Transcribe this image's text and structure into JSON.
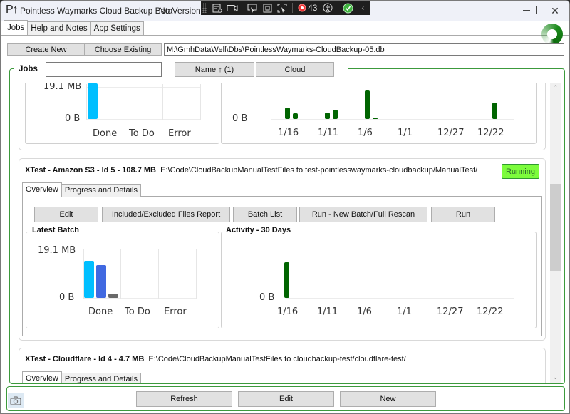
{
  "window": {
    "app_logo": "P↑",
    "title": "Pointless Waymarks Cloud Backup Beta",
    "version": "No Version",
    "minimize_glyph": "—",
    "maximize_glyph": "☐",
    "close_glyph": "✕"
  },
  "debug_toolbar": {
    "items": [
      "live-visual-tree-icon",
      "record-icon",
      "select-element-icon",
      "display-layout-adorners-icon",
      "track-focused-element-icon"
    ],
    "binding_failures": "43",
    "accessibility_icon": "☺",
    "status": "ok",
    "collapse_glyph": "‹"
  },
  "tabs": [
    {
      "label": "Jobs",
      "active": true
    },
    {
      "label": "Help and Notes",
      "active": false
    },
    {
      "label": "App Settings",
      "active": false
    }
  ],
  "database": {
    "create_new_label": "Create New",
    "choose_existing_label": "Choose Existing",
    "path": "M:\\GmhDataWell\\Dbs\\PointlessWaymarks-CloudBackup-05.db"
  },
  "jobs": {
    "legend": "Jobs",
    "filter_value": "",
    "sort_name_label": "Name ↑ (1)",
    "sort_cloud_label": "Cloud",
    "partial_card": {
      "latest_batch": {
        "y_max_label": "19.1 MB",
        "y_min_label": "0 B",
        "categories": [
          "Done",
          "To Do",
          "Error"
        ],
        "bars": [
          {
            "category": "Done",
            "color": "#00bfff",
            "fraction": 1.0
          }
        ]
      },
      "activity": {
        "y_min_label": "0 B",
        "x_labels": [
          "1/16",
          "1/11",
          "1/6",
          "1/1",
          "12/27",
          "12/22"
        ],
        "bars": [
          {
            "day_offset": 0,
            "fraction": 0.4
          },
          {
            "day_offset": 1,
            "fraction": 0.2
          },
          {
            "day_offset": 5,
            "fraction": 0.23
          },
          {
            "day_offset": 6,
            "fraction": 0.33
          },
          {
            "day_offset": 10,
            "fraction": 1.0
          },
          {
            "day_offset": 11,
            "fraction": 0.03
          },
          {
            "day_offset": 26,
            "fraction": 0.58
          }
        ]
      }
    },
    "cards": [
      {
        "name": "XTest - Amazon S3 - Id 5 - 108.7 MB",
        "description": "E:\\Code\\CloudBackupManualTestFiles to test-pointlesswaymarks-cloudbackup/ManualTest/",
        "status": "Running",
        "tabs": [
          {
            "label": "Overview",
            "active": true
          },
          {
            "label": "Progress and Details",
            "active": false
          }
        ],
        "buttons": [
          "Edit",
          "Included/Excluded Files Report",
          "Batch List",
          "Run - New Batch/Full Rescan",
          "Run"
        ],
        "latest_batch": {
          "title": "Latest Batch",
          "y_max_label": "19.1 MB",
          "y_min_label": "0 B",
          "categories": [
            "Done",
            "To Do",
            "Error"
          ],
          "bars": [
            {
              "category": "Done",
              "series": "uploaded",
              "color": "#00bfff",
              "fraction": 0.82
            },
            {
              "category": "Done",
              "series": "in-progress",
              "color": "#4169e1",
              "fraction": 0.72
            },
            {
              "category": "Done",
              "series": "other",
              "color": "#696969",
              "fraction": 0.1
            }
          ]
        },
        "activity": {
          "title": "Activity - 30 Days",
          "y_min_label": "0 B",
          "x_labels": [
            "1/16",
            "1/11",
            "1/6",
            "1/1",
            "12/27",
            "12/22"
          ],
          "bars": [
            {
              "day_offset": 0,
              "fraction": 1.0
            }
          ]
        }
      },
      {
        "name": "XTest - Cloudflare - Id 4 - 4.7 MB",
        "description": "E:\\Code\\CloudBackupManualTestFiles to cloudbackup-test/cloudflare-test/",
        "tabs": [
          {
            "label": "Overview",
            "active": true
          },
          {
            "label": "Progress and Details",
            "active": false
          }
        ]
      }
    ]
  },
  "footer": {
    "refresh_label": "Refresh",
    "edit_label": "Edit",
    "new_label": "New"
  },
  "colors": {
    "accent_green": "#3c9a3c",
    "activity_bar": "#006400",
    "running_badge": "#7cfc3c"
  }
}
